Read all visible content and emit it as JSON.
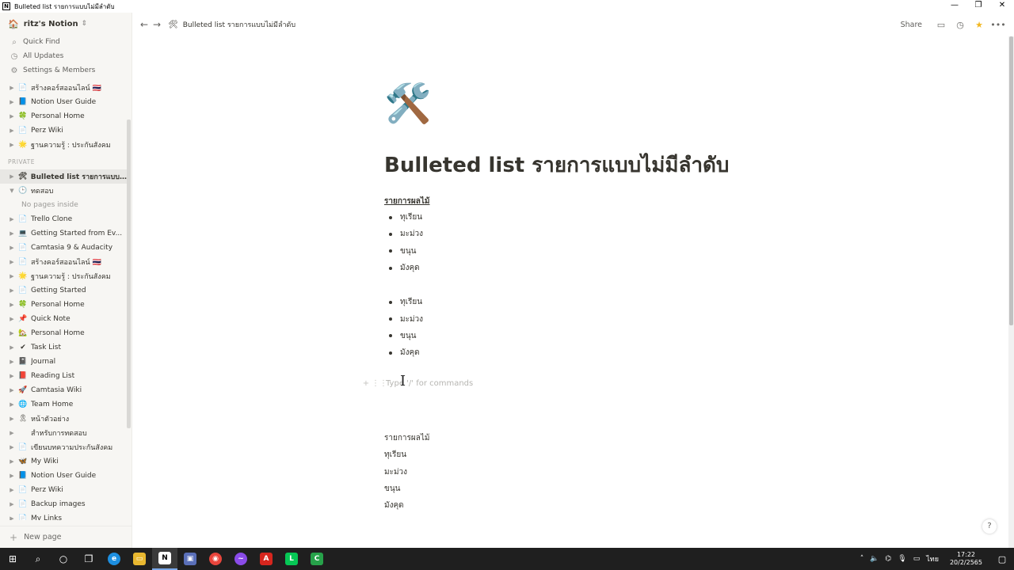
{
  "window": {
    "title": "Bulleted list รายการแบบไม่มีลำดับ",
    "app_icon_letter": "N",
    "min": "—",
    "restore": "❐",
    "close": "✕"
  },
  "sidebar": {
    "workspace": "ritz's Notion",
    "nav": [
      {
        "label": "Quick Find",
        "icon": "search-icon"
      },
      {
        "label": "All Updates",
        "icon": "clock-icon"
      },
      {
        "label": "Settings & Members",
        "icon": "gear-icon"
      }
    ],
    "shared_items": [
      {
        "label": "สร้างคอร์สออนไลน์ 🇹🇭",
        "icon": "📄"
      },
      {
        "label": "Notion User Guide",
        "icon": "📘"
      },
      {
        "label": "Personal Home",
        "icon": "🍀"
      },
      {
        "label": "Perz Wiki",
        "icon": "📄"
      },
      {
        "label": "ฐานความรู้ : ประกันสังคม",
        "icon": "🌟"
      }
    ],
    "private_label": "PRIVATE",
    "private_items": [
      {
        "label": "Bulleted list รายการแบบ...",
        "icon": "🛠",
        "active": true
      },
      {
        "label": "ทดสอบ",
        "icon": "🕒",
        "expanded": true
      },
      {
        "label": "No pages inside",
        "empty": true
      },
      {
        "label": "Trello Clone",
        "icon": "📄"
      },
      {
        "label": "Getting Started from Ev...",
        "icon": "💻"
      },
      {
        "label": "Camtasia 9 & Audacity",
        "icon": "📄"
      },
      {
        "label": "สร้างคอร์สออนไลน์ 🇹🇭",
        "icon": "📄"
      },
      {
        "label": "ฐานความรู้ : ประกันสังคม",
        "icon": "🌟"
      },
      {
        "label": "Getting Started",
        "icon": "📄"
      },
      {
        "label": "Personal Home",
        "icon": "🍀"
      },
      {
        "label": "Quick Note",
        "icon": "📌"
      },
      {
        "label": "Personal Home",
        "icon": "🏡"
      },
      {
        "label": "Task List",
        "icon": "✔"
      },
      {
        "label": "Journal",
        "icon": "📓"
      },
      {
        "label": "Reading List",
        "icon": "📕"
      },
      {
        "label": "Camtasia Wiki",
        "icon": "🚀"
      },
      {
        "label": "Team Home",
        "icon": "🌐"
      },
      {
        "label": "หน้าตัวอย่าง",
        "icon": "🎗"
      },
      {
        "label": "สำหรับการทดสอบ",
        "icon": ""
      },
      {
        "label": "เขียนบทความประกันสังคม",
        "icon": "📄"
      },
      {
        "label": "My Wiki",
        "icon": "🦋"
      },
      {
        "label": "Notion User Guide",
        "icon": "📘"
      },
      {
        "label": "Perz Wiki",
        "icon": "📄"
      },
      {
        "label": "Backup images",
        "icon": "📄"
      },
      {
        "label": "My Links",
        "icon": "📄"
      }
    ],
    "new_page": "New page"
  },
  "topbar": {
    "breadcrumb": "Bulleted list รายการแบบไม่มีลำดับ",
    "share": "Share"
  },
  "page": {
    "icon": "🛠️",
    "title": "Bulleted list รายการแบบไม่มีลำดับ",
    "heading": "รายการผลไม้",
    "list1": [
      "ทุเรียน",
      "มะม่วง",
      "ขนุน",
      "มังคุด"
    ],
    "list2": [
      "ทุเรียน",
      "มะม่วง",
      "ขนุน",
      "มังคุด"
    ],
    "placeholder": "Type '/' for commands",
    "plain_heading": "รายการผลไม้",
    "plain_items": [
      "ทุเรียน",
      "มะม่วง",
      "ขนุน",
      "มังคุด"
    ]
  },
  "taskbar": {
    "time": "17:22",
    "date": "20/2/2565",
    "lang": "ไทย"
  }
}
